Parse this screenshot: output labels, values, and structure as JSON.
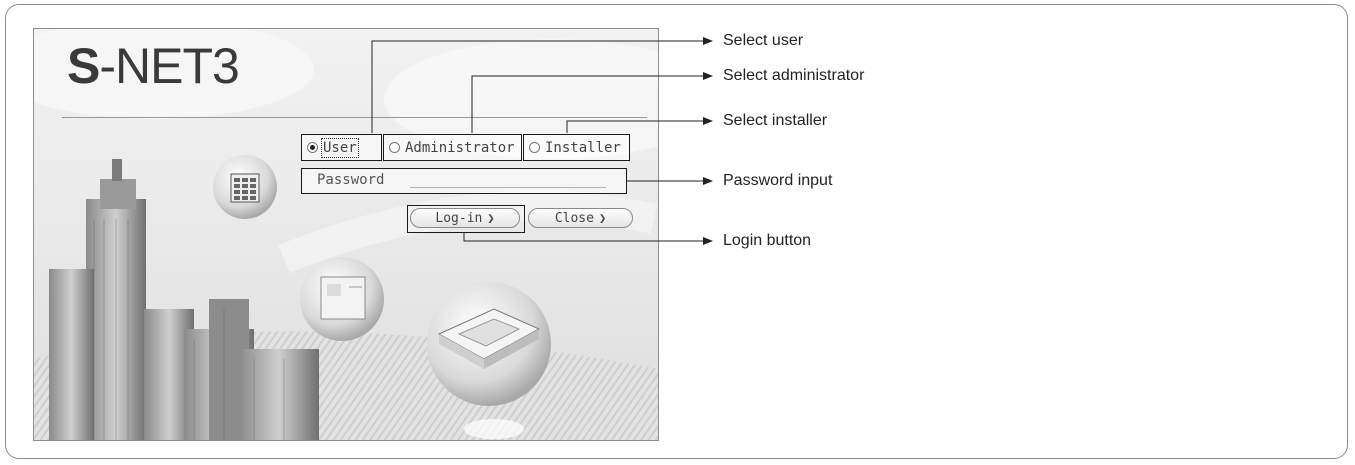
{
  "app": {
    "logo_bold": "S",
    "logo_rest": "-NET3"
  },
  "login": {
    "roles": [
      {
        "label": "User",
        "selected": true
      },
      {
        "label": "Administrator",
        "selected": false
      },
      {
        "label": "Installer",
        "selected": false
      }
    ],
    "password_label": "Password",
    "password_value": "",
    "login_button": "Log-in",
    "close_button": "Close"
  },
  "callouts": {
    "select_user": "Select user",
    "select_administrator": "Select administrator",
    "select_installer": "Select installer",
    "password_input": "Password input",
    "login_button": "Login button"
  },
  "colors": {
    "frame": "#8a8a8a",
    "outline": "#1a1a1a",
    "text": "#222222"
  },
  "icons": [
    "radio-selected-icon",
    "radio-unselected-icon",
    "chevron-right-icon",
    "arrow-right-icon"
  ]
}
